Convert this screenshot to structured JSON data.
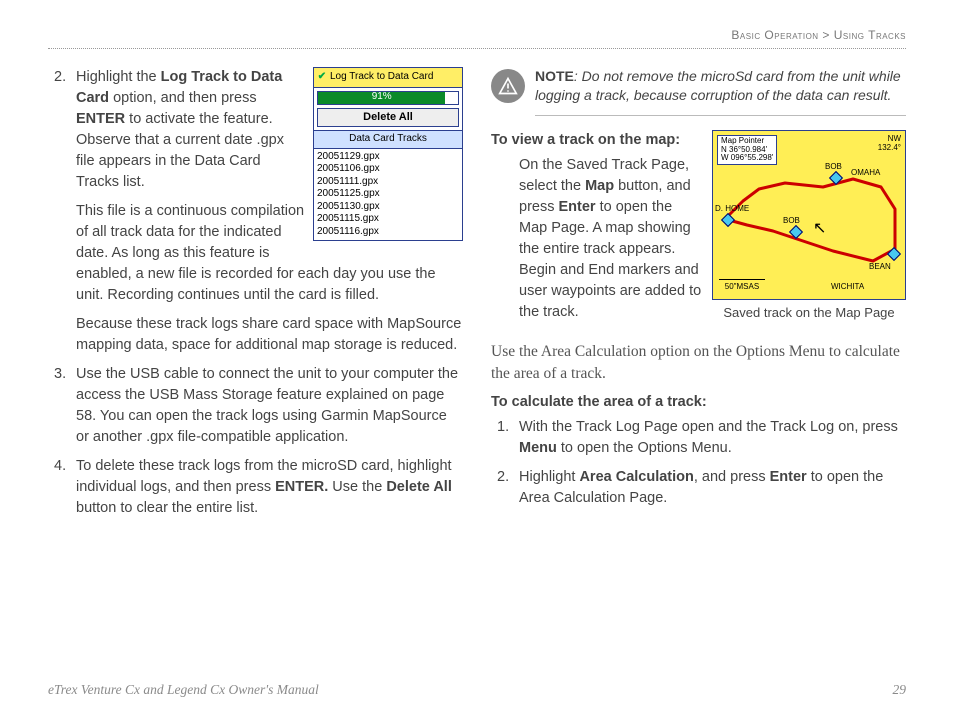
{
  "header": {
    "breadcrumb_left": "Basic Operation",
    "breadcrumb_sep": " > ",
    "breadcrumb_right": "Using Tracks"
  },
  "left": {
    "step2_num": "2.",
    "step2_a1": "Highlight the ",
    "step2_b1": "Log Track to Data Card",
    "step2_a2": " option, and then press ",
    "step2_b2": "ENTER",
    "step2_a3": " to activate the feature. Observe that a current date .gpx file appears in the Data Card Tracks list.",
    "step2_p2": "This file is a continuous compilation of all track data for the indicated date. As long as this feature is enabled, a new file is recorded for each day you use the unit. Recording continues until the card is filled.",
    "step2_p3": "Because these track logs share card space with MapSource mapping data, space for additional map storage is reduced.",
    "step3_num": "3.",
    "step3": "Use the USB cable to connect the unit to your computer the access the USB Mass Storage feature explained on page 58. You can open the track logs using Garmin MapSource or another .gpx file-compatible application.",
    "step4_num": "4.",
    "step4_a1": "To delete these track logs from the microSD card, highlight individual logs, and then press ",
    "step4_b1": "ENTER.",
    "step4_a2": " Use the ",
    "step4_b2": "Delete All",
    "step4_a3": " button to clear the entire list."
  },
  "fig1": {
    "toprow": "Log Track to Data Card",
    "percent": "91%",
    "delete_all": "Delete All",
    "section": "Data Card Tracks",
    "files": [
      "20051129.gpx",
      "20051106.gpx",
      "20051111.gpx",
      "20051125.gpx",
      "20051130.gpx",
      "20051115.gpx",
      "20051116.gpx"
    ]
  },
  "right": {
    "note_b": "NOTE",
    "note_i": ": Do not remove the microSd card from the unit while logging a track, because corruption of the data can result.",
    "view_head": "To view a track on the map:",
    "view_a1": "On the Saved Track Page, select the ",
    "view_b1": "Map",
    "view_a2": " button, and press ",
    "view_b2": "Enter",
    "view_a3": " to open the Map Page. A map showing the entire track appears. Begin and End markers and user waypoints are added to the track.",
    "map_caption": "Saved track on the Map Page",
    "area_serif": "Use the Area Calculation option on the Options Menu to calculate the area of a track.",
    "calc_head": "To calculate the area of a track:",
    "calc1_num": "1.",
    "calc1_a1": "With the Track Log Page open and the Track Log on, press ",
    "calc1_b1": "Menu",
    "calc1_a2": " to open the Options Menu.",
    "calc2_num": "2.",
    "calc2_a1": "Highlight ",
    "calc2_b1": "Area Calculation",
    "calc2_a2": ", and press ",
    "calc2_b2": "Enter",
    "calc2_a3": " to open the Area Calculation Page."
  },
  "map": {
    "info_title": "Map Pointer",
    "info_lat": "N  36°50.984'",
    "info_lon": "W 096°55.298'",
    "corner1": "NW",
    "corner2": "132.4°",
    "lbl_home": "D. HOME",
    "lbl_bob1": "BOB",
    "lbl_bob2": "BOB",
    "lbl_omaha": "OMAHA",
    "lbl_bean": "BEAN",
    "lbl_wichita": "WICHITA",
    "scale": "50\"MSAS"
  },
  "footer": {
    "title": "eTrex Venture Cx and Legend Cx Owner's Manual",
    "page": "29"
  }
}
